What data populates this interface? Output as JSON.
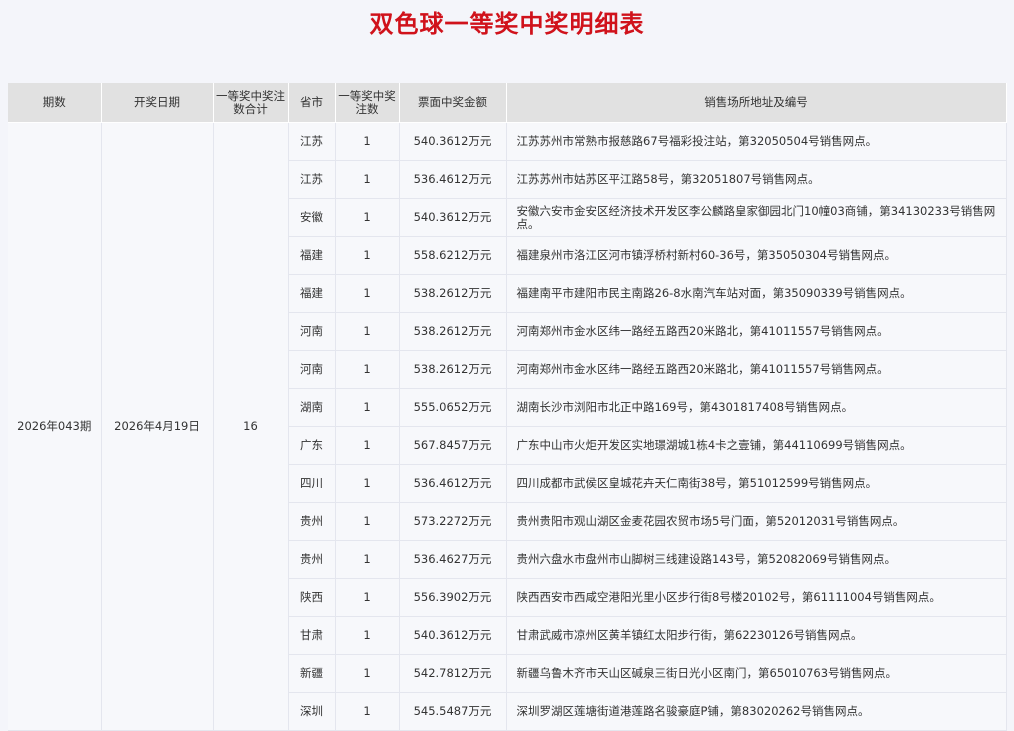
{
  "title": "双色球一等奖中奖明细表",
  "headers": {
    "period": "期数",
    "date": "开奖日期",
    "total": "一等奖中奖注数合计",
    "province": "省市",
    "count": "一等奖中奖注数",
    "amount": "票面中奖金额",
    "address": "销售场所地址及编号"
  },
  "summary": {
    "period": "2026年043期",
    "date": "2026年4月19日",
    "total": "16"
  },
  "rows": [
    {
      "province": "江苏",
      "count": "1",
      "amount": "540.3612万元",
      "address": "江苏苏州市常熟市报慈路67号福彩投注站，第32050504号销售网点。"
    },
    {
      "province": "江苏",
      "count": "1",
      "amount": "536.4612万元",
      "address": "江苏苏州市姑苏区平江路58号，第32051807号销售网点。"
    },
    {
      "province": "安徽",
      "count": "1",
      "amount": "540.3612万元",
      "address": "安徽六安市金安区经济技术开发区李公麟路皇家御园北门10幢03商铺，第34130233号销售网点。"
    },
    {
      "province": "福建",
      "count": "1",
      "amount": "558.6212万元",
      "address": "福建泉州市洛江区河市镇浮桥村新村60-36号，第35050304号销售网点。"
    },
    {
      "province": "福建",
      "count": "1",
      "amount": "538.2612万元",
      "address": "福建南平市建阳市民主南路26-8水南汽车站对面，第35090339号销售网点。"
    },
    {
      "province": "河南",
      "count": "1",
      "amount": "538.2612万元",
      "address": "河南郑州市金水区纬一路经五路西20米路北，第41011557号销售网点。"
    },
    {
      "province": "河南",
      "count": "1",
      "amount": "538.2612万元",
      "address": "河南郑州市金水区纬一路经五路西20米路北，第41011557号销售网点。"
    },
    {
      "province": "湖南",
      "count": "1",
      "amount": "555.0652万元",
      "address": "湖南长沙市浏阳市北正中路169号，第4301817408号销售网点。"
    },
    {
      "province": "广东",
      "count": "1",
      "amount": "567.8457万元",
      "address": "广东中山市火炬开发区实地璟湖城1栋4卡之壹铺，第44110699号销售网点。"
    },
    {
      "province": "四川",
      "count": "1",
      "amount": "536.4612万元",
      "address": "四川成都市武侯区皇城花卉天仁南街38号，第51012599号销售网点。"
    },
    {
      "province": "贵州",
      "count": "1",
      "amount": "573.2272万元",
      "address": "贵州贵阳市观山湖区金麦花园农贸市场5号门面，第52012031号销售网点。"
    },
    {
      "province": "贵州",
      "count": "1",
      "amount": "536.4627万元",
      "address": "贵州六盘水市盘州市山脚树三线建设路143号，第52082069号销售网点。"
    },
    {
      "province": "陕西",
      "count": "1",
      "amount": "556.3902万元",
      "address": "陕西西安市西咸空港阳光里小区步行街8号楼20102号，第61111004号销售网点。"
    },
    {
      "province": "甘肃",
      "count": "1",
      "amount": "540.3612万元",
      "address": "甘肃武威市凉州区黄羊镇红太阳步行街，第62230126号销售网点。"
    },
    {
      "province": "新疆",
      "count": "1",
      "amount": "542.7812万元",
      "address": "新疆乌鲁木齐市天山区碱泉三街日光小区南门，第65010763号销售网点。"
    },
    {
      "province": "深圳",
      "count": "1",
      "amount": "545.5487万元",
      "address": "深圳罗湖区莲塘街道港莲路名骏豪庭P铺，第83020262号销售网点。"
    }
  ]
}
